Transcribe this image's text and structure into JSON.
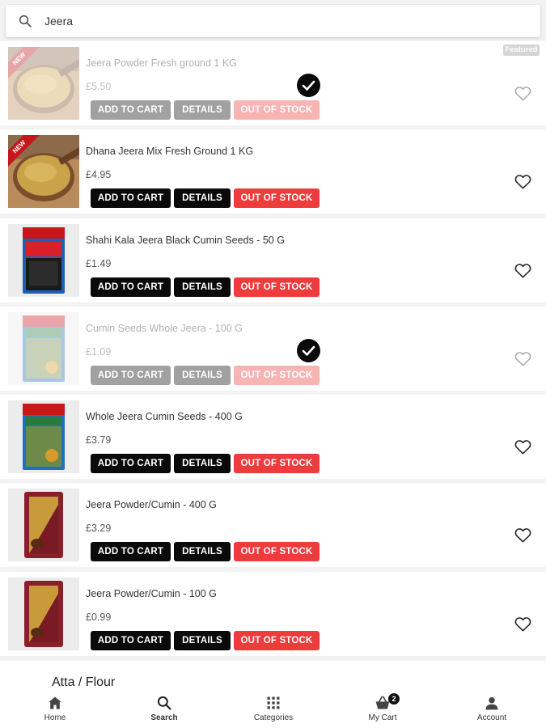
{
  "search": {
    "query": "Jeera",
    "icon": "search-icon"
  },
  "products": [
    {
      "name": "Jeera Powder Fresh ground 1 KG",
      "price": "£5.50",
      "add_to_cart": "ADD TO CART",
      "details": "DETAILS",
      "stock_status": "OUT OF STOCK",
      "badge": "NEW",
      "featured": "Featured",
      "in_cart": true,
      "image": "jeera-powder-bowl"
    },
    {
      "name": "Dhana Jeera Mix Fresh Ground 1 KG",
      "price": "£4.95",
      "add_to_cart": "ADD TO CART",
      "details": "DETAILS",
      "stock_status": "OUT OF STOCK",
      "badge": "NEW",
      "in_cart": false,
      "image": "dhana-jeera-bowl"
    },
    {
      "name": "Shahi Kala Jeera Black Cumin Seeds - 50 G",
      "price": "£1.49",
      "add_to_cart": "ADD TO CART",
      "details": "DETAILS",
      "stock_status": "OUT OF STOCK",
      "in_cart": false,
      "image": "black-cumin-packet"
    },
    {
      "name": "Cumin Seeds Whole Jeera - 100 G",
      "price": "£1.09",
      "add_to_cart": "ADD TO CART",
      "details": "DETAILS",
      "stock_status": "OUT OF STOCK",
      "in_cart": true,
      "image": "cumin-seeds-packet"
    },
    {
      "name": "Whole Jeera Cumin Seeds - 400 G",
      "price": "£3.79",
      "add_to_cart": "ADD TO CART",
      "details": "DETAILS",
      "stock_status": "OUT OF STOCK",
      "in_cart": false,
      "image": "cumin-seeds-packet-large"
    },
    {
      "name": "Jeera Powder/Cumin - 400 G",
      "price": "£3.29",
      "add_to_cart": "ADD TO CART",
      "details": "DETAILS",
      "stock_status": "OUT OF STOCK",
      "in_cart": false,
      "image": "jeera-powder-packet"
    },
    {
      "name": "Jeera Powder/Cumin - 100 G",
      "price": "£0.99",
      "add_to_cart": "ADD TO CART",
      "details": "DETAILS",
      "stock_status": "OUT OF STOCK",
      "in_cart": false,
      "image": "jeera-powder-packet-small"
    }
  ],
  "category_strip": "Atta / Flour",
  "bottom_nav": {
    "items": [
      {
        "label": "Home",
        "icon": "home-icon"
      },
      {
        "label": "Search",
        "icon": "search-icon",
        "active": true
      },
      {
        "label": "Categories",
        "icon": "grid-icon"
      },
      {
        "label": "My Cart",
        "icon": "basket-icon",
        "badge": "2"
      },
      {
        "label": "Account",
        "icon": "person-icon"
      }
    ]
  },
  "colors": {
    "out_of_stock": "#ee3b3b",
    "button_dark": "#0a0a0a",
    "new_badge": "#c4161c"
  }
}
